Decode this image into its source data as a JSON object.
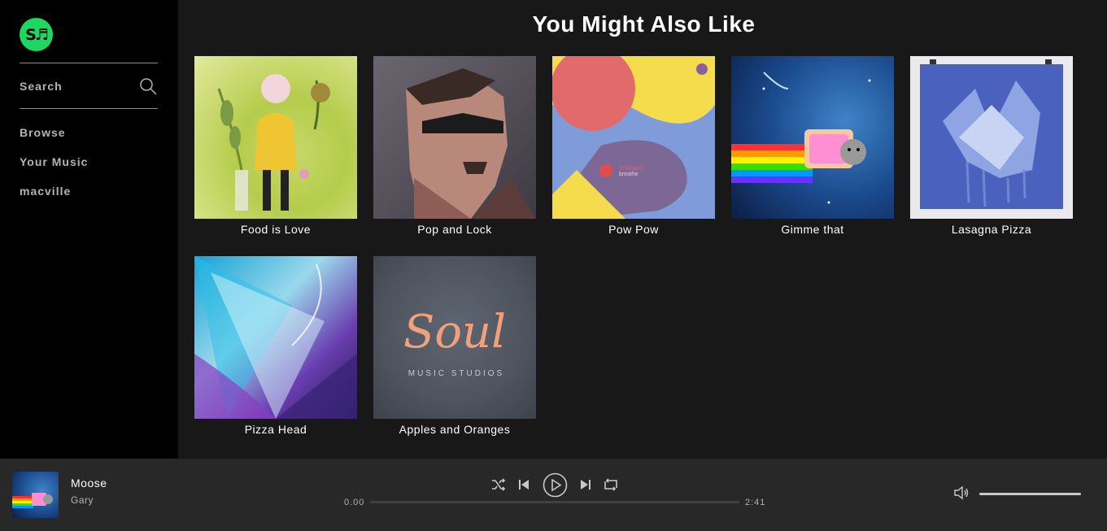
{
  "sidebar": {
    "logo_text": "S♬",
    "search_label": "Search",
    "items": [
      {
        "label": "Browse"
      },
      {
        "label": "Your Music"
      },
      {
        "label": "macville"
      }
    ]
  },
  "main": {
    "title": "You Might Also Like",
    "albums": [
      {
        "label": "Food is Love",
        "art": "plant-girl-illustration"
      },
      {
        "label": "Pop and Lock",
        "art": "lowpoly-man-portrait"
      },
      {
        "label": "Pow Pow",
        "art": "abstract-shapes"
      },
      {
        "label": "Gimme that",
        "art": "nyan-cat-space"
      },
      {
        "label": "Lasagna Pizza",
        "art": "blue-graffiti-sculpture"
      },
      {
        "label": "Pizza Head",
        "art": "blue-fractal-light"
      },
      {
        "label": "Apples and Oranges",
        "art": "soul-music-studios-logo"
      }
    ]
  },
  "player": {
    "track_title": "Moose",
    "track_artist": "Gary",
    "current_time": "0.00",
    "total_time": "2:41",
    "progress": 0,
    "volume": 1.0,
    "icons": [
      "shuffle-icon",
      "previous-icon",
      "play-icon",
      "next-icon",
      "repeat-icon",
      "volume-icon"
    ]
  },
  "art_text": {
    "pow_brand": "STREAMS",
    "pow_sub": "breathe",
    "soul_word": "Soul",
    "soul_sub": "MUSIC STUDIOS"
  },
  "colors": {
    "brand": "#1ed760",
    "sidebar_bg": "#000000",
    "main_bg": "#181818",
    "player_bg": "#282828"
  }
}
